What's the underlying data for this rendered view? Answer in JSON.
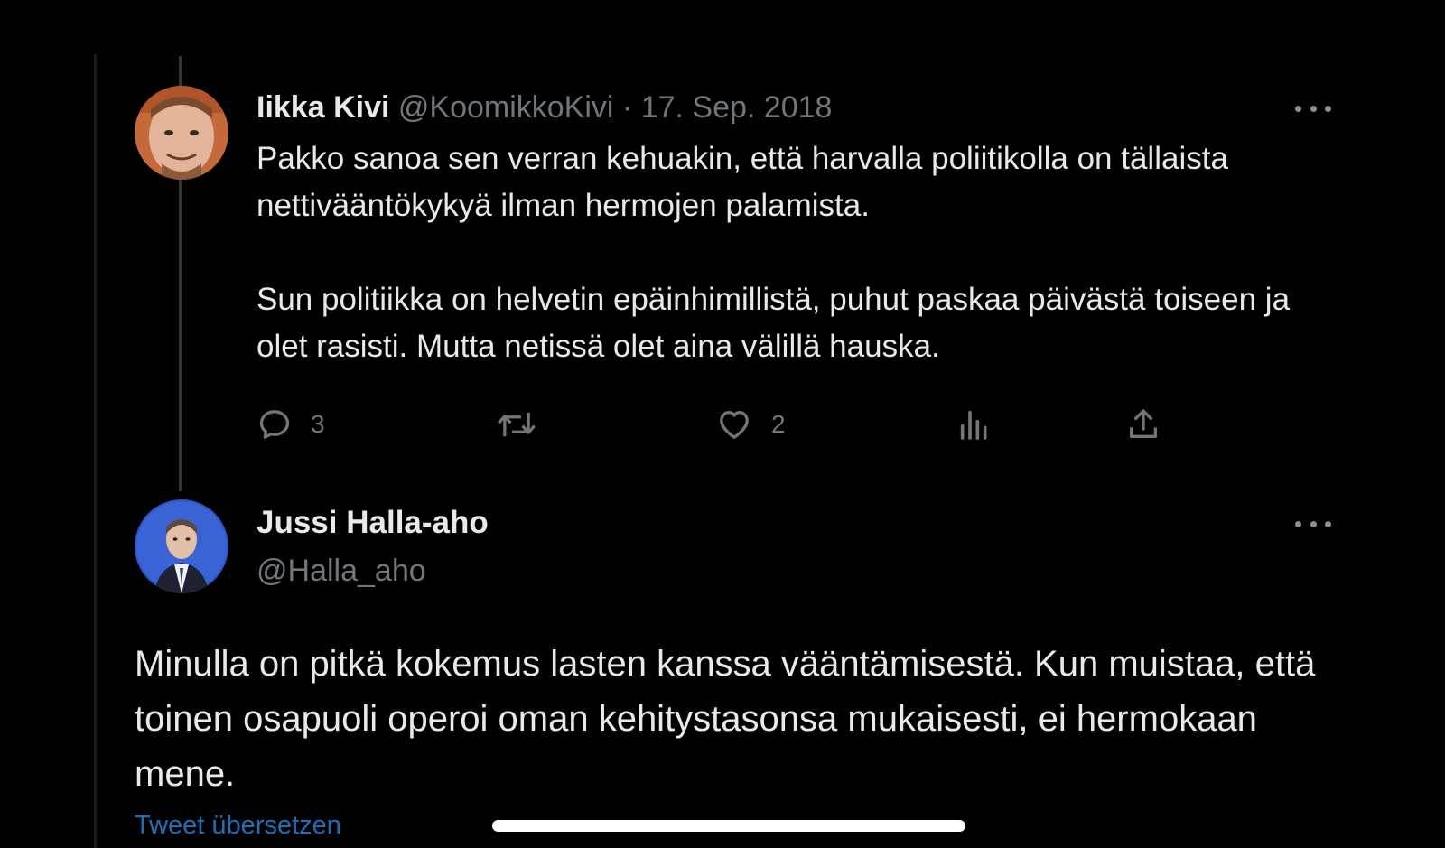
{
  "parent_tweet": {
    "author_name": "Iikka Kivi",
    "handle": "@KoomikkoKivi",
    "separator": "·",
    "date": "17. Sep. 2018",
    "paragraphs": [
      "Pakko sanoa sen verran kehuakin, että harvalla poliitikolla on tällaista nettivääntökykyä ilman hermojen palamista.",
      "Sun politiikka on helvetin epäinhimillistä, puhut paskaa päivästä toiseen ja olet rasisti. Mutta netissä olet aina välillä hauska."
    ],
    "reply_count": "3",
    "like_count": "2",
    "icons": [
      "reply-icon",
      "repost-icon",
      "like-icon",
      "views-icon",
      "share-icon",
      "more-icon"
    ]
  },
  "reply_tweet": {
    "author_name": "Jussi Halla-aho",
    "handle": "@Halla_aho",
    "text": "Minulla on pitkä kokemus lasten kanssa vääntämisestä. Kun muistaa, että toinen osapuoli operoi oman kehitystasonsa mukaisesti, ei hermokaan mene.",
    "translate_label": "Tweet übersetzen",
    "icons": [
      "more-icon"
    ]
  },
  "colors": {
    "background": "#000000",
    "text": "#e7e9ea",
    "muted": "#71767b",
    "link": "#1d6fb8"
  }
}
